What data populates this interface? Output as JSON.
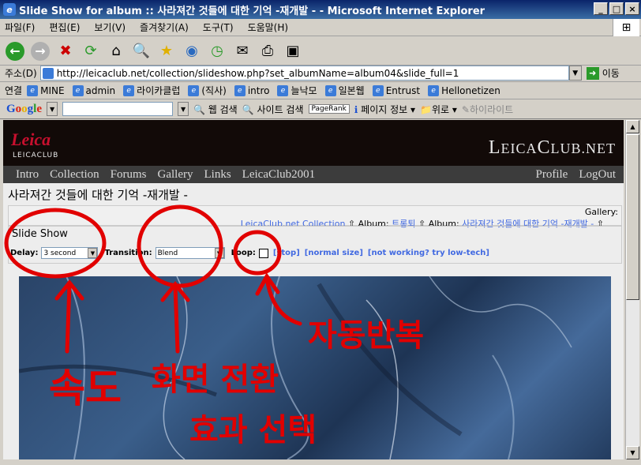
{
  "window": {
    "title": "Slide Show for album :: 사라져간 것들에 대한 기억 -재개발 - - Microsoft Internet Explorer"
  },
  "menu": [
    "파일(F)",
    "편집(E)",
    "보기(V)",
    "즐겨찾기(A)",
    "도구(T)",
    "도움말(H)"
  ],
  "address": {
    "label": "주소(D)",
    "url": "http://leicaclub.net/collection/slideshow.php?set_albumName=album04&slide_full=1",
    "go": "이동"
  },
  "links": {
    "label": "연결",
    "items": [
      "MINE",
      "admin",
      "라이카클럽",
      "(직사)",
      "intro",
      "늘낙모",
      "일본웹",
      "Entrust",
      "Hellonetizen"
    ]
  },
  "google": {
    "logo": "Google",
    "web_search": "웹 검색",
    "site_search": "사이트 검색",
    "pagerank": "PageRank",
    "page_info": "페이지 정보",
    "up": "위로",
    "highlight": "하이라이트"
  },
  "site": {
    "brand": "Leica",
    "brand_sub": "LEICACLUB",
    "name": "LeicaClub.net",
    "nav_left": [
      "Intro",
      "Collection",
      "Forums",
      "Gallery",
      "Links",
      "LeicaClub2001"
    ],
    "nav_right": [
      "Profile",
      "LogOut"
    ]
  },
  "page": {
    "title": "사라져간 것들에 대한 기억 -재개발 -",
    "gallery_label": "Gallery:",
    "crumb_root": "LeicaClub.net Collection",
    "crumb_album_label": "Album:",
    "crumb_album1": "트롱퇴",
    "crumb_album2": "사라져간 것들에 대한 기억 -재개발 -"
  },
  "slideshow": {
    "title": "Slide Show",
    "delay_label": "Delay:",
    "delay_value": "3 second",
    "transition_label": "Transition:",
    "transition_value": "Blend",
    "loop_label": "Loop:",
    "stop": "[stop]",
    "normal_size": "[normal size]",
    "low_tech": "[not working? try low-tech]"
  },
  "annotations": {
    "speed": "속도",
    "transition1": "화면 전환",
    "transition2": "효과 선택",
    "loop": "자동반복"
  },
  "colors": {
    "annotation": "#e10000",
    "brand_red": "#c8102e",
    "link_blue": "#4169e1"
  }
}
